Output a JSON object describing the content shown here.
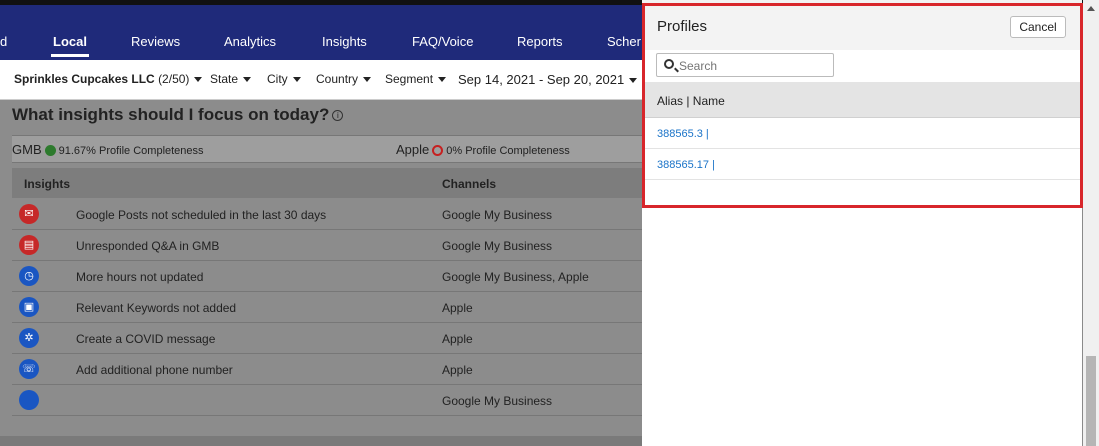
{
  "nav": {
    "items": [
      {
        "label": "d",
        "active": false
      },
      {
        "label": "Local",
        "active": true
      },
      {
        "label": "Reviews",
        "active": false
      },
      {
        "label": "Analytics",
        "active": false
      },
      {
        "label": "Insights",
        "active": false
      },
      {
        "label": "FAQ/Voice",
        "active": false
      },
      {
        "label": "Reports",
        "active": false
      },
      {
        "label": "Scher",
        "active": false
      }
    ]
  },
  "filters": {
    "account_name": "Sprinkles Cupcakes LLC",
    "account_count": "(2/50)",
    "state": "State",
    "city": "City",
    "country": "Country",
    "segment": "Segment",
    "date_range": "Sep 14, 2021 - Sep 20, 2021"
  },
  "insights": {
    "heading": "What insights should I focus on today?",
    "gmb_label": "GMB",
    "gmb_completeness": "91.67% Profile Completeness",
    "apple_label": "Apple",
    "apple_completeness": "0% Profile Completeness",
    "col_insights": "Insights",
    "col_channels": "Channels",
    "rows": [
      {
        "icon": "mail-icon",
        "color": "red",
        "text": "Google Posts not scheduled in the last 30 days",
        "channel": "Google My Business"
      },
      {
        "icon": "chat-icon",
        "color": "red",
        "text": "Unresponded Q&A in GMB",
        "channel": "Google My Business"
      },
      {
        "icon": "clock-icon",
        "color": "blue",
        "text": "More hours not updated",
        "channel": "Google My Business, Apple"
      },
      {
        "icon": "keyword-icon",
        "color": "blue",
        "text": "Relevant Keywords not added",
        "channel": "Apple"
      },
      {
        "icon": "virus-icon",
        "color": "blue",
        "text": "Create a COVID message",
        "channel": "Apple"
      },
      {
        "icon": "phone-icon",
        "color": "blue",
        "text": "Add additional phone number",
        "channel": "Apple"
      },
      {
        "icon": "blank-icon",
        "color": "blue",
        "text": "",
        "channel": "Google My Business"
      }
    ]
  },
  "profiles_panel": {
    "title": "Profiles",
    "cancel_label": "Cancel",
    "search_placeholder": "Search",
    "column_header": "Alias | Name",
    "profiles": [
      {
        "label": "388565.3 |"
      },
      {
        "label": "388565.17 |"
      }
    ]
  },
  "colors": {
    "nav_bg": "#1f2a7a",
    "highlight_outline": "#d8262b",
    "link": "#1a73c8"
  }
}
